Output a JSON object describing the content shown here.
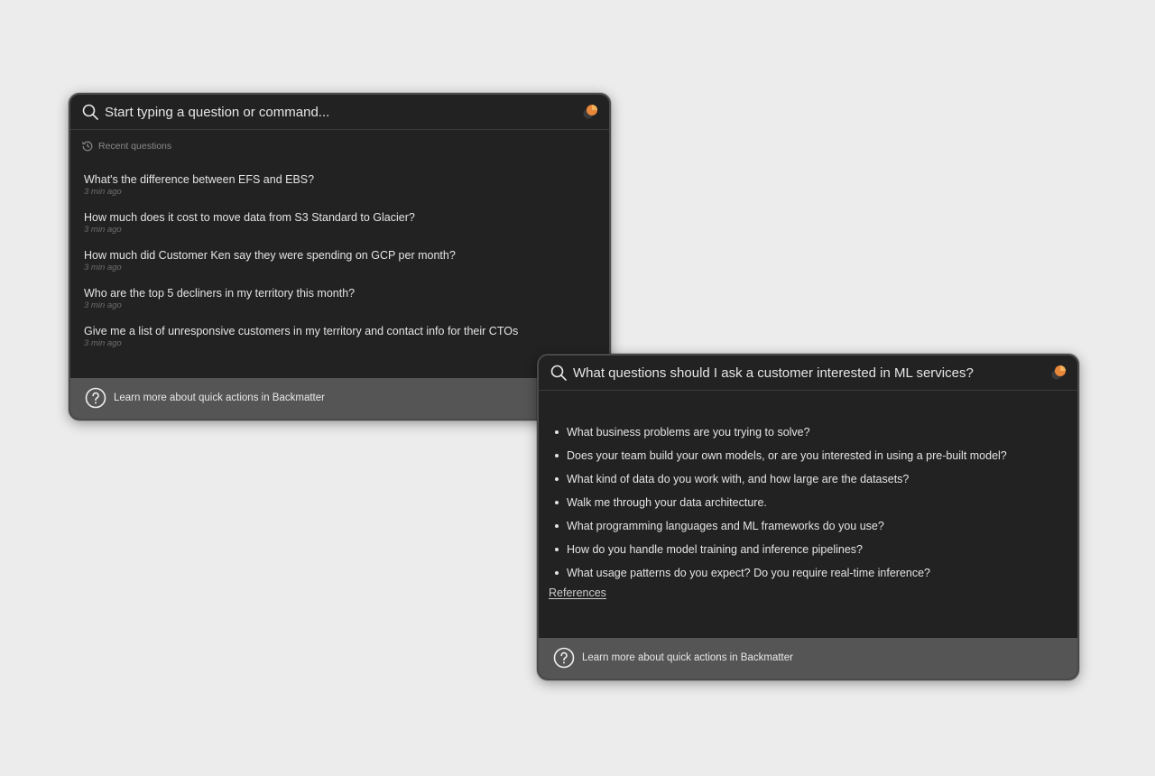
{
  "colors": {
    "background": "#ececec",
    "panel_bg": "#222223",
    "footer_bg": "#555556",
    "logo_orange": "#e8873a"
  },
  "command_panel": {
    "search_placeholder": "Start typing a question or command...",
    "recent_label": "Recent questions",
    "recent": [
      {
        "question": "What's the difference between EFS and EBS?",
        "time": "3 min ago"
      },
      {
        "question": "How much does it cost to move data from S3 Standard to Glacier?",
        "time": "3 min ago"
      },
      {
        "question": "How much did Customer Ken say they were spending on GCP per month?",
        "time": "3 min ago"
      },
      {
        "question": "Who are the top 5 decliners in my territory this month?",
        "time": "3 min ago"
      },
      {
        "question": "Give me a list of unresponsive customers in my territory and contact info for their CTOs",
        "time": "3 min ago"
      }
    ],
    "footer_text": "Learn more about quick actions in Backmatter"
  },
  "answer_panel": {
    "query": "What questions should I ask a customer interested in ML services?",
    "answers": [
      "What business problems are you trying to solve?",
      "Does your team build your own models, or are you interested in using a pre-built model?",
      "What kind of data do you work with, and how large are the datasets?",
      "Walk me through your data architecture.",
      "What programming languages and ML frameworks do you use?",
      "How do you handle model training and inference pipelines?",
      "What usage patterns do you expect? Do you require real-time inference?"
    ],
    "references_label": "References",
    "footer_text": "Learn more about quick actions in Backmatter"
  }
}
